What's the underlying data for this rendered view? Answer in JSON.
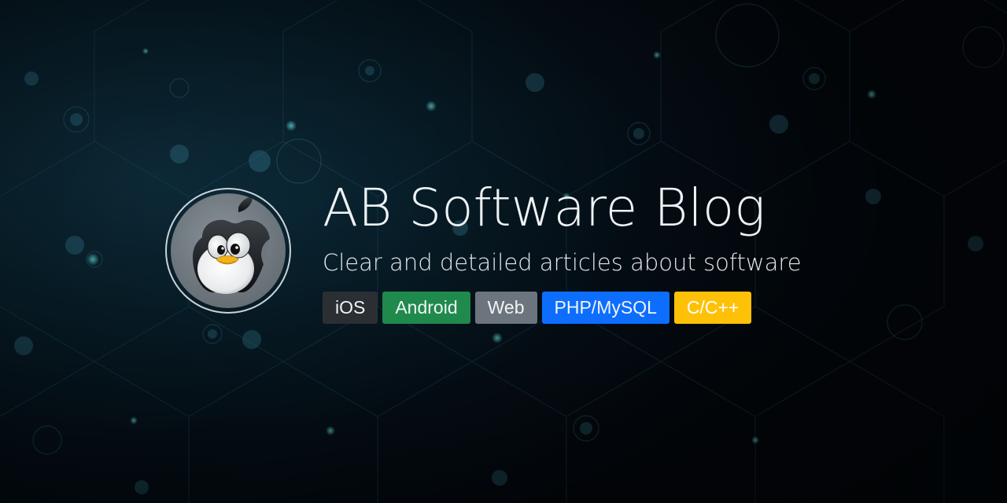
{
  "banner": {
    "title": "AB Software Blog",
    "subtitle": "Clear and detailed articles about software",
    "logo_icon": "penguin-apple-icon"
  },
  "tags": [
    {
      "label": "iOS",
      "color": "#2b2f33",
      "text_color": "#f1f4f6"
    },
    {
      "label": "Android",
      "color": "#1f8a4c",
      "text_color": "#f1f4f6"
    },
    {
      "label": "Web",
      "color": "#6c757d",
      "text_color": "#f1f4f6"
    },
    {
      "label": "PHP/MySQL",
      "color": "#0d6efd",
      "text_color": "#f1f4f6"
    },
    {
      "label": "C/C++",
      "color": "#ffc107",
      "text_color": "#ffffff"
    }
  ]
}
